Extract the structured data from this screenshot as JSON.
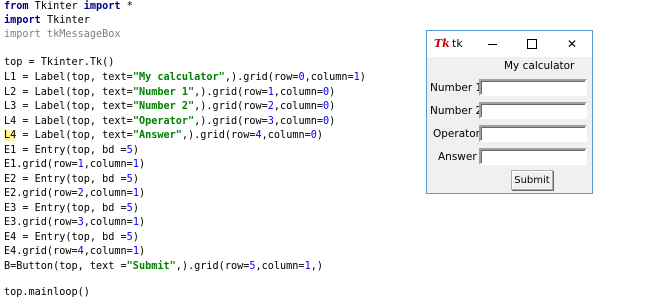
{
  "code": {
    "l1_kw1": "from",
    "l1_mod": " Tkinter ",
    "l1_kw2": "import",
    "l1_rest": " *",
    "l2_kw": "import",
    "l2_rest": " Tkinter",
    "l3_text": "import tkMessageBox",
    "l5_text": "top = Tkinter.Tk()",
    "l6_a": "L1 = Label(top, text=",
    "l6_s": "\"My calculator\"",
    "l6_b": ",).grid(row=",
    "l6_n1": "0",
    "l6_c": ",column=",
    "l6_n2": "1",
    "l6_d": ")",
    "l7_a": "L2 = Label(top, text=",
    "l7_s": "\"Number 1\"",
    "l7_b": ",).grid(row=",
    "l7_n1": "1",
    "l7_c": ",column=",
    "l7_n2": "0",
    "l7_d": ")",
    "l8_a": "L3 = Label(top, text=",
    "l8_s": "\"Number 2\"",
    "l8_b": ",).grid(row=",
    "l8_n1": "2",
    "l8_c": ",column=",
    "l8_n2": "0",
    "l8_d": ")",
    "l9_a": "L4 = Label(top, text=",
    "l9_s": "\"Operator\"",
    "l9_b": ",).grid(row=",
    "l9_n1": "3",
    "l9_c": ",column=",
    "l9_n2": "0",
    "l9_d": ")",
    "l10_hl": "L4",
    "l10_a": " = Label(top, text=",
    "l10_s": "\"Answer\"",
    "l10_b": ",).grid(row=",
    "l10_n1": "4",
    "l10_c": ",column=",
    "l10_n2": "0",
    "l10_d": ")",
    "l11_a": "E1 = Entry(top, bd =",
    "l11_n": "5",
    "l11_b": ")",
    "l12_a": "E1.grid(row=",
    "l12_n1": "1",
    "l12_b": ",column=",
    "l12_n2": "1",
    "l12_c": ")",
    "l13_a": "E2 = Entry(top, bd =",
    "l13_n": "5",
    "l13_b": ")",
    "l14_a": "E2.grid(row=",
    "l14_n1": "2",
    "l14_b": ",column=",
    "l14_n2": "1",
    "l14_c": ")",
    "l15_a": "E3 = Entry(top, bd =",
    "l15_n": "5",
    "l15_b": ")",
    "l16_a": "E3.grid(row=",
    "l16_n1": "3",
    "l16_b": ",column=",
    "l16_n2": "1",
    "l16_c": ")",
    "l17_a": "E4 = Entry(top, bd =",
    "l17_n": "5",
    "l17_b": ")",
    "l18_a": "E4.grid(row=",
    "l18_n1": "4",
    "l18_b": ",column=",
    "l18_n2": "1",
    "l18_c": ")",
    "l19_a": "B=Button(top, text =",
    "l19_s": "\"Submit\"",
    "l19_b": ",).grid(row=",
    "l19_n1": "5",
    "l19_c": ",column=",
    "l19_n2": "1",
    "l19_d": ",)",
    "l21_text": "top.mainloop()"
  },
  "window": {
    "icon": "Tk",
    "title": "tk",
    "minimize_icon": "minimize-icon",
    "maximize_icon": "maximize-icon",
    "close_symbol": "✕"
  },
  "form": {
    "heading": "My calculator",
    "number1_label": "Number 1",
    "number2_label": "Number 2",
    "operator_label": "Operator",
    "answer_label": "Answer",
    "number1_value": "",
    "number2_value": "",
    "operator_value": "",
    "answer_value": "",
    "submit_label": "Submit"
  },
  "colors": {
    "keyword": "#00007f",
    "string": "#008000",
    "number": "#0000ff",
    "comment_dim": "#7f7f7f",
    "highlight": "#fff5a8",
    "window_border": "#5b9bd5",
    "window_bg": "#f0f0f0",
    "tk_logo": "#c00000"
  }
}
